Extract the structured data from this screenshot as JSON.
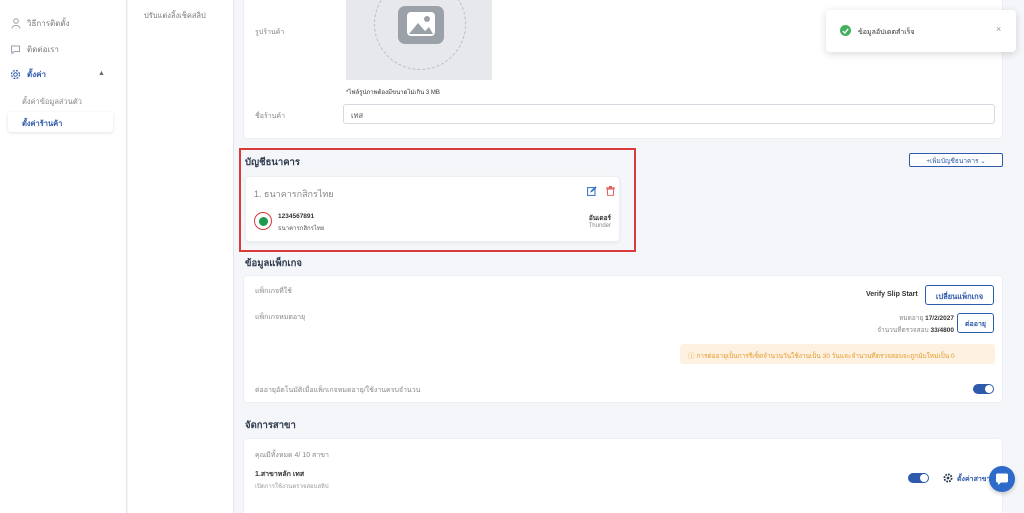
{
  "sidebar": {
    "items": [
      {
        "label": "วิธีการติดตั้ง",
        "icon": "person-icon"
      },
      {
        "label": "ติดต่อเรา",
        "icon": "chat-icon"
      },
      {
        "label": "ตั้งค่า",
        "icon": "gear-icon"
      }
    ],
    "sub_items": [
      {
        "label": "ตั้งค่าข้อมูลส่วนตัว"
      },
      {
        "label": "ตั้งค่าร้านค้า"
      }
    ]
  },
  "subnav": {
    "link": "ปรับแต่งลิ้งเช็คสลิป"
  },
  "store": {
    "image_label": "รูปร้านค้า",
    "image_hint": "*ไฟล์รูปภาพต้องมีขนาดไม่เกิน 3 MB",
    "name_label": "ชื่อร้านค้า",
    "name_value": "เทส"
  },
  "bank": {
    "section_title": "บัญชีธนาคาร",
    "add_button": "+เพิ่มบัญชีธนาคาร",
    "account": {
      "title": "1. ธนาคารกสิกรไทย",
      "account_number": "1234567891",
      "bank_name": "ธนาคารกสิกรไทย",
      "account_name": "อันเดอร์",
      "provider": "Thunder"
    }
  },
  "package": {
    "section_title": "ข้อมูลแพ็กเกจ",
    "current_label": "แพ็กเกจที่ใช้",
    "current_value": "Verify Slip Start",
    "change_button": "เปลี่ยนแพ็กเกจ",
    "expiry_label": "แพ็กเกจหมดอายุ",
    "expiry_prefix": "หมดอายุ ",
    "expiry_date": "17/2/2027",
    "quota_prefix": "จำนวนที่ตรวจสอบ ",
    "quota_value": "33/4800",
    "renew_button": "ต่ออายุ",
    "warning": "การต่ออายุเป็นการรีเซ็ตจำนวนวันใช้งานเป็น 30 วันและจำนวนที่ตรวจสอบจะถูกนับใหม่เป็น 0",
    "auto_renew_label": "ต่ออายุอัตโนมัติเมื่อแพ็กเกจหมดอายุ/ใช้งานครบจำนวน",
    "auto_renew_on": true
  },
  "branch": {
    "section_title": "จัดการสาขา",
    "count_text": "คุณมีทั้งหมด 4/ 10 สาขา",
    "name": "1.สาขาหลัก เทส",
    "description": "เปิดการใช้งานตรวจสอบสลิป",
    "settings_label": "ตั้งค่าสาขา"
  },
  "toast": {
    "message": "ข้อมูลอัปเดตสำเร็จ"
  },
  "colors": {
    "accent": "#2e5aac",
    "highlight": "#d93a3a",
    "success": "#43b05c",
    "warning": "#e89a2a"
  }
}
